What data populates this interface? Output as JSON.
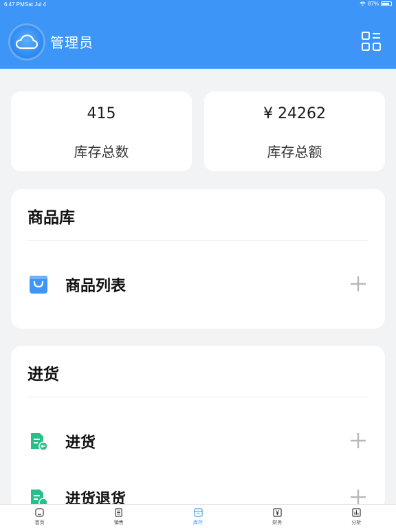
{
  "status_bar": {
    "time": "6:47 PM",
    "date": "Sat Jul 4",
    "battery": "87%",
    "battery_level": 0.87
  },
  "header": {
    "title": "管理员",
    "avatar_icon": "cloud-icon",
    "menu_icon": "grid-menu-icon",
    "background_color": "#3d96f7"
  },
  "stats": [
    {
      "value": "415",
      "label": "库存总数"
    },
    {
      "value": "¥ 24262",
      "label": "库存总额"
    }
  ],
  "sections": {
    "goods": {
      "title": "商品库",
      "items": [
        {
          "label": "商品列表",
          "icon": "shopping-bag-icon"
        }
      ]
    },
    "purchase": {
      "title": "进货",
      "items": [
        {
          "label": "进货",
          "icon": "purchase-doc-icon"
        },
        {
          "label": "进货退货",
          "icon": "purchase-return-icon"
        }
      ]
    }
  },
  "tabs": [
    {
      "label": "首页",
      "icon": "home-icon",
      "active": false
    },
    {
      "label": "销售",
      "icon": "sales-doc-icon",
      "active": false
    },
    {
      "label": "库存",
      "icon": "inventory-box-icon",
      "active": true
    },
    {
      "label": "财务",
      "icon": "yen-icon",
      "active": false
    },
    {
      "label": "分析",
      "icon": "bar-chart-icon",
      "active": false
    }
  ],
  "colors": {
    "accent": "#3d96f7",
    "green_icon": "#27c08a",
    "plus_gray": "#b8b8b8"
  }
}
